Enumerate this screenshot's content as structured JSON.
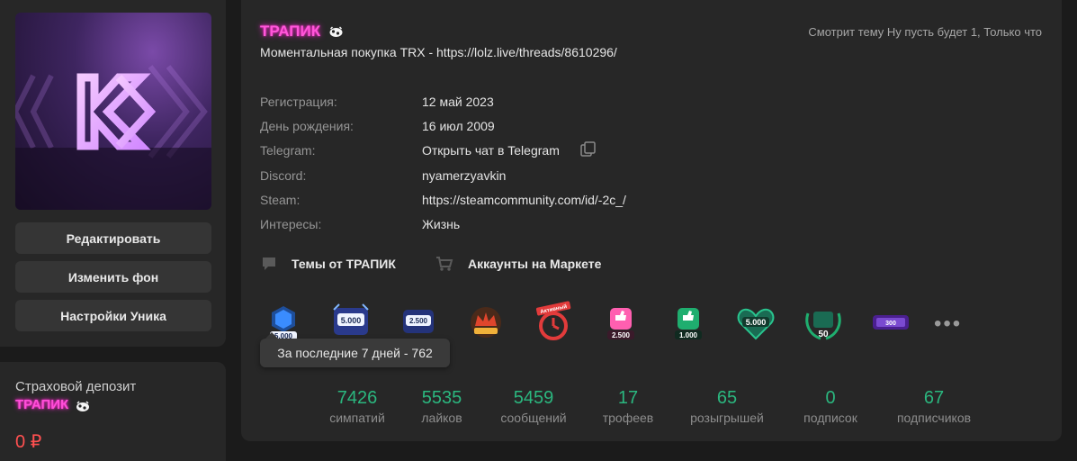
{
  "sidebar": {
    "avatar_letter": "K",
    "buttons": [
      "Редактировать",
      "Изменить фон",
      "Настройки Уника"
    ]
  },
  "deposit": {
    "title": "Страховой депозит",
    "nickname": "ТРАПИК",
    "amount": "0 ₽"
  },
  "profile": {
    "nickname": "ТРАПИК",
    "status": "Моментальная покупка TRX - https://lolz.live/threads/8610296/",
    "activity": "Смотрит тему Ну пусть будет 1, Только что",
    "info": [
      {
        "label": "Регистрация:",
        "value": "12 май 2023"
      },
      {
        "label": "День рождения:",
        "value": "16 июл 2009"
      },
      {
        "label": "Telegram:",
        "value": "Открыть чат в Telegram"
      },
      {
        "label": "Discord:",
        "value": "nyamerzyavkin"
      },
      {
        "label": "Steam:",
        "value": "https://steamcommunity.com/id/-2c_/"
      },
      {
        "label": "Интересы:",
        "value": "Жизнь"
      }
    ],
    "links": {
      "threads": "Темы от ТРАПИК",
      "market": "Аккаунты на Маркете"
    },
    "trophies": [
      "5.000",
      "5.000",
      "2.500",
      "",
      "Активный",
      "2.500",
      "1.000",
      "5.000",
      "50",
      "300"
    ],
    "more": "•••",
    "tooltip": "За последние 7 дней - 762",
    "stats": [
      {
        "value": "7426",
        "label": "симпатий"
      },
      {
        "value": "5535",
        "label": "лайков"
      },
      {
        "value": "5459",
        "label": "сообщений"
      },
      {
        "value": "17",
        "label": "трофеев"
      },
      {
        "value": "65",
        "label": "розыгрышей"
      },
      {
        "value": "0",
        "label": "подписок"
      },
      {
        "value": "67",
        "label": "подписчиков"
      }
    ]
  },
  "colors": {
    "accent_green": "#2bb77f",
    "nick_pink": "#ff57d9",
    "deposit_red": "#ff5050",
    "panel": "#272727"
  }
}
